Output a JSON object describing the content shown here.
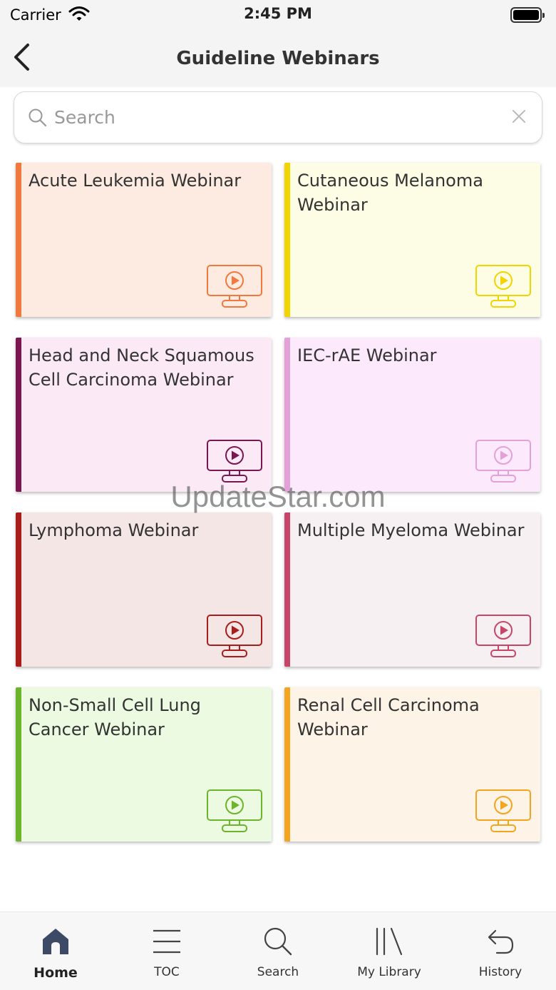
{
  "status_bar": {
    "carrier": "Carrier",
    "time": "2:45 PM"
  },
  "nav": {
    "title": "Guideline Webinars",
    "back_icon": "chevron-left-icon"
  },
  "search": {
    "placeholder": "Search",
    "value": "",
    "clear_icon": "close-icon"
  },
  "cards": [
    {
      "title": "Acute Leukemia Webinar",
      "accent": "#f07a3e",
      "bg": "#fdeae1"
    },
    {
      "title": "Cutaneous Melanoma Webinar",
      "accent": "#f2d400",
      "bg": "#fdfde6"
    },
    {
      "title": "Head and Neck Squamous Cell Carcinoma Webinar",
      "accent": "#7a1650",
      "bg": "#fbeaf6"
    },
    {
      "title": "IEC-rAE Webinar",
      "accent": "#e6a0d8",
      "bg": "#fce9fb"
    },
    {
      "title": "Lymphoma Webinar",
      "accent": "#a91c1c",
      "bg": "#f4e6e4"
    },
    {
      "title": "Multiple Myeloma Webinar",
      "accent": "#c8456a",
      "bg": "#f6f0f2"
    },
    {
      "title": "Non-Small Cell Lung Cancer Webinar",
      "accent": "#6cb42a",
      "bg": "#ecfae2"
    },
    {
      "title": "Renal Cell Carcinoma Webinar",
      "accent": "#f3a51f",
      "bg": "#fdf3e7"
    }
  ],
  "tabs": [
    {
      "label": "Home",
      "icon": "home-icon",
      "active": true
    },
    {
      "label": "TOC",
      "icon": "menu-icon",
      "active": false
    },
    {
      "label": "Search",
      "icon": "search-icon",
      "active": false
    },
    {
      "label": "My Library",
      "icon": "library-icon",
      "active": false
    },
    {
      "label": "History",
      "icon": "history-icon",
      "active": false
    }
  ],
  "watermark": "UpdateStar.com"
}
